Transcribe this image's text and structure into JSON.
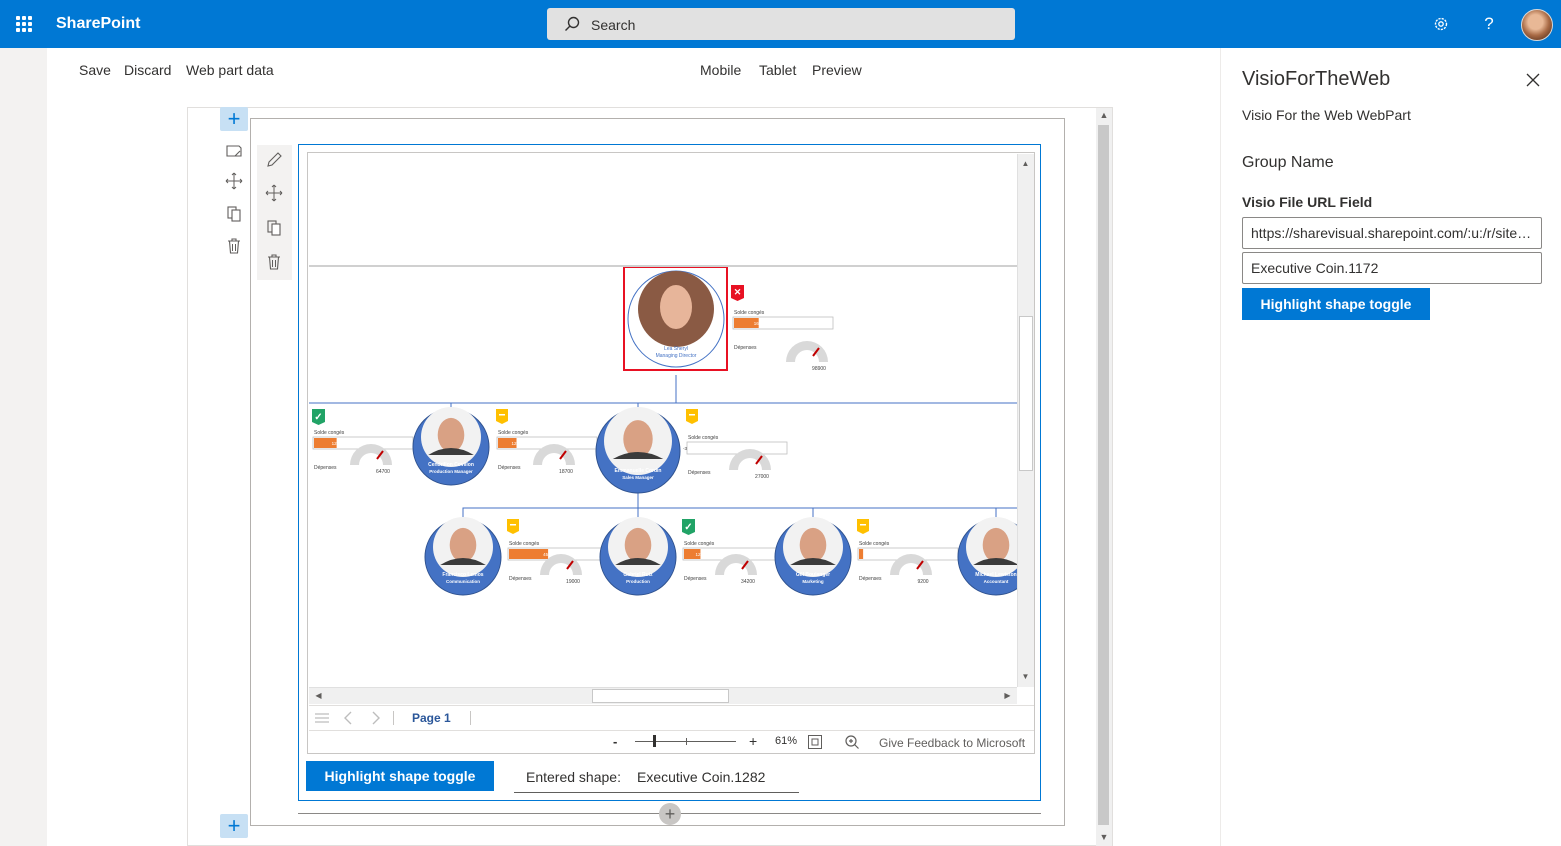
{
  "suite": {
    "brand": "SharePoint",
    "search_placeholder": "Search",
    "settings_icon": "gear-icon",
    "help_icon": "help-icon"
  },
  "commands": {
    "save": "Save",
    "discard": "Discard",
    "web_part_data": "Web part data",
    "mobile": "Mobile",
    "tablet": "Tablet",
    "preview": "Preview"
  },
  "visio": {
    "page_label": "Page 1",
    "zoom_minus": "-",
    "zoom_plus": "+",
    "zoom_level": "61%",
    "feedback": "Give Feedback to Microsoft",
    "zoom_slider_fraction": 0.18
  },
  "org_chart": {
    "gauge_label": "Dépenses",
    "bar_label": "Solde congés",
    "nodes": [
      {
        "name": "Lea Sheryl",
        "title": "Managing Director",
        "bar_text": "16",
        "bar_fill": 0.6,
        "gauge": "98900",
        "status": "red-x",
        "highlighted": true
      },
      {
        "name": "",
        "title": "",
        "bar_text": "12",
        "bar_fill": 0.55,
        "gauge": "64700",
        "status": "green-check"
      },
      {
        "name": "Cendrillon Covillon",
        "title": "Production Manager",
        "bar_text": "12",
        "bar_fill": 0.45,
        "gauge": "18700",
        "status": "yellow-dash"
      },
      {
        "name": "Emmanuelle Cordin",
        "title": "Sales Manager",
        "bar_text": "-3",
        "bar_fill": 0.0,
        "gauge": "27000",
        "status": "yellow-dash"
      },
      {
        "name": "Francisco Lemos",
        "title": "Communication",
        "bar_text": "45",
        "bar_fill": 0.95,
        "gauge": "19000",
        "status": "yellow-dash"
      },
      {
        "name": "Gabriel Ruiz",
        "title": "Production",
        "bar_text": "12",
        "bar_fill": 0.4,
        "gauge": "34200",
        "status": "green-check"
      },
      {
        "name": "Gill Boulanger",
        "title": "Marketing",
        "bar_text": "",
        "bar_fill": 0.1,
        "gauge": "9200",
        "status": "yellow-dash"
      },
      {
        "name": "Michael Lewiston",
        "title": "Accountant",
        "bar_text": "",
        "bar_fill": 0,
        "gauge": "",
        "status": ""
      }
    ]
  },
  "webpart": {
    "highlight_button": "Highlight shape toggle",
    "entered_label": "Entered shape:",
    "entered_value": "Executive Coin.1282"
  },
  "pane": {
    "title": "VisioForTheWeb",
    "description": "Visio For the Web WebPart",
    "group_name": "Group Name",
    "url_label": "Visio File URL Field",
    "url_value": "https://sharevisual.sharepoint.com/:u:/r/sites/...",
    "shape_value": "Executive Coin.1172",
    "highlight_button": "Highlight shape toggle"
  },
  "colors": {
    "brand": "#0078d4",
    "bar_orange": "#ed7d31",
    "node_blue": "#4472c4",
    "highlight_red": "#e81123"
  }
}
